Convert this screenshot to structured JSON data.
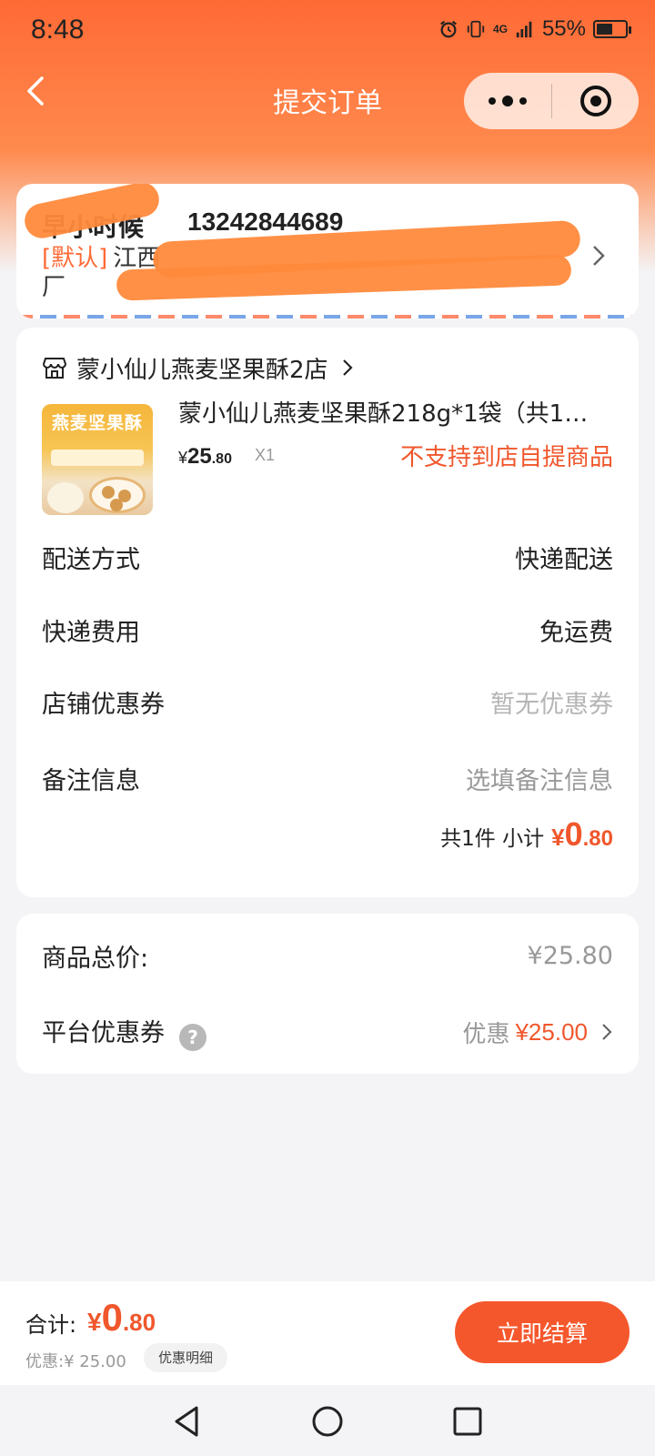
{
  "status_bar": {
    "time": "8:48",
    "network": "4G",
    "battery_pct": "55%",
    "battery_level": 0.55
  },
  "nav": {
    "title": "提交订单"
  },
  "address": {
    "name": "早小时候",
    "phone": "13242844689",
    "default_tag": "[默认]",
    "line": "江西",
    "line_end": "厂"
  },
  "shop": {
    "name": "蒙小仙儿燕麦坚果酥2店"
  },
  "product": {
    "image_text": "燕麦坚果酥",
    "title": "蒙小仙儿燕麦坚果酥218g*1袋（共15…",
    "price_symbol": "¥",
    "price_int": "25",
    "price_dec": ".80",
    "qty": "X1",
    "note": "不支持到店自提商品"
  },
  "rows": {
    "delivery": {
      "label": "配送方式",
      "value": "快递配送"
    },
    "shipping": {
      "label": "快递费用",
      "value": "免运费"
    },
    "coupon": {
      "label": "店铺优惠券",
      "value": "暂无优惠券"
    },
    "remark": {
      "label": "备注信息",
      "value": "选填备注信息"
    }
  },
  "subtotal": {
    "text": "共1件 小计",
    "symbol": "¥",
    "int": "0",
    "dec": ".80"
  },
  "totals": {
    "goods_label": "商品总价:",
    "goods_value": "¥25.80",
    "platform_label": "平台优惠券",
    "help": "?",
    "discount_prefix": "优惠",
    "discount_value": "¥25.00"
  },
  "bottom": {
    "label": "合计:",
    "symbol": "¥",
    "int": "0",
    "dec": ".80",
    "discount": "优惠:¥ 25.00",
    "detail_btn": "优惠明细",
    "pay_btn": "立即结算"
  },
  "colors": {
    "accent": "#f0572c",
    "header": "#ff6a35",
    "button": "#f5572c"
  }
}
